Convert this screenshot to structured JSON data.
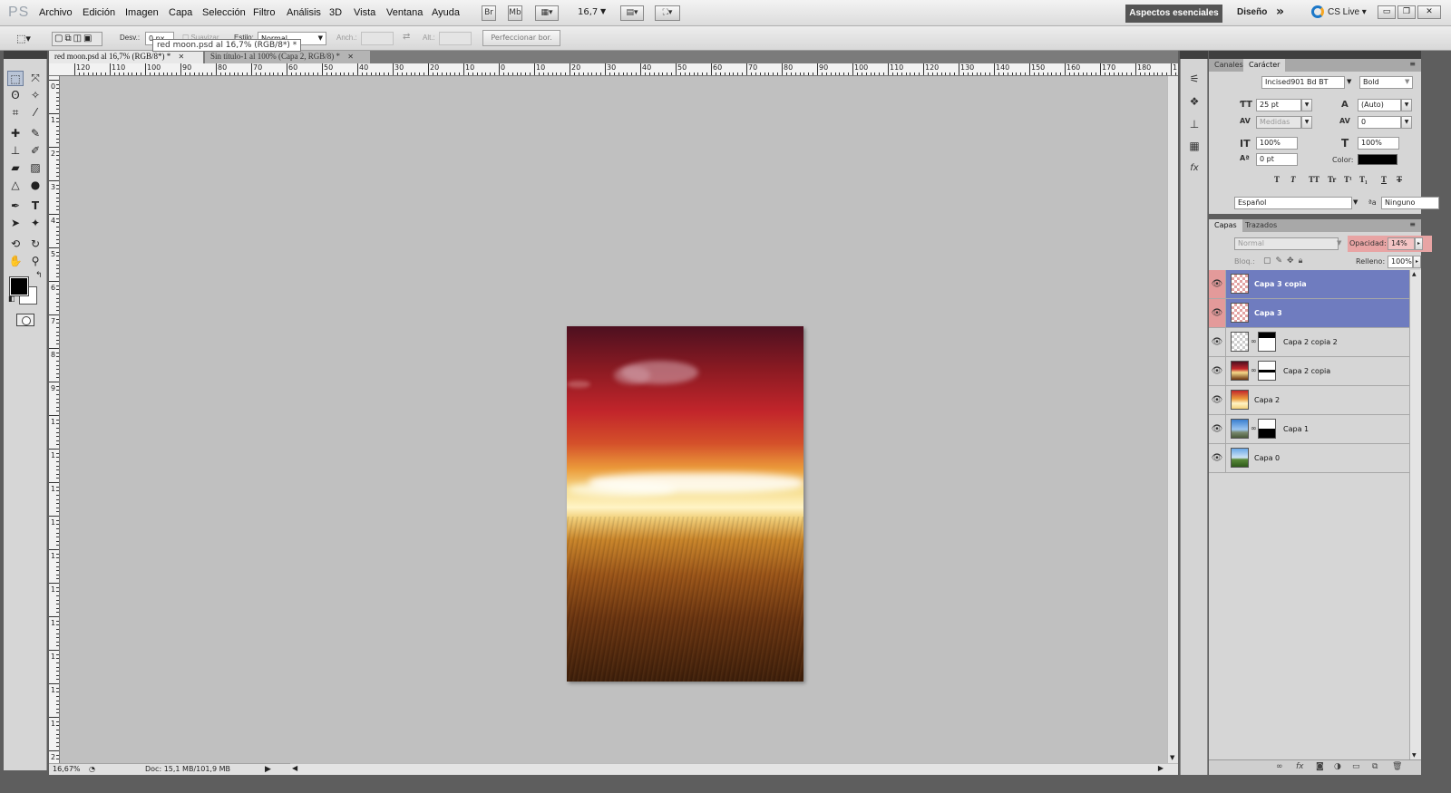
{
  "app": {
    "logo": "PS",
    "menu": [
      "Archivo",
      "Edición",
      "Imagen",
      "Capa",
      "Selección",
      "Filtro",
      "Análisis",
      "3D",
      "Vista",
      "Ventana",
      "Ayuda"
    ],
    "bridge_btn": "Br",
    "minibridge_btn": "Mb",
    "zoom_value": "16,7",
    "workspace": "Aspectos esenciales",
    "workspace_alt": "Diseño",
    "more_workspaces": "»",
    "cs_live": "CS Live",
    "win_minimize": "▭",
    "win_restore": "❐",
    "win_close": "✕"
  },
  "options": {
    "feather_label": "Desv.:",
    "feather_value": "0 px",
    "antialias_label": "Suavizar",
    "style_label": "Estilo:",
    "style_value": "Normal",
    "width_label": "Anch.:",
    "height_label": "Alt.:",
    "refine_edge": "Perfeccionar bor.",
    "tooltip": "red moon.psd al 16,7% (RGB/8*) *"
  },
  "doc_tabs": [
    {
      "label": "red moon.psd al 16,7% (RGB/8*) *",
      "close": "✕"
    },
    {
      "label": "Sin título-1 al 100% (Capa 2, RGB/8) *",
      "close": "✕"
    }
  ],
  "ruler": {
    "h_labels": [
      "120",
      "110",
      "100",
      "90",
      "80",
      "70",
      "60",
      "50",
      "40",
      "30",
      "20",
      "10",
      "0",
      "10",
      "20",
      "30",
      "40",
      "50",
      "60",
      "70",
      "80",
      "90",
      "100",
      "110",
      "120",
      "130",
      "140",
      "150",
      "160",
      "170",
      "180",
      "1"
    ],
    "v_labels": [
      "0",
      "1",
      "2",
      "3",
      "4",
      "5",
      "6",
      "7",
      "8",
      "9",
      "1",
      "1",
      "1",
      "1",
      "1",
      "1",
      "1",
      "1",
      "1",
      "1",
      "2",
      "2"
    ]
  },
  "status": {
    "zoom": "16,67%",
    "doc": "Doc: 15,1 MB/101,9 MB",
    "arrow": "▶"
  },
  "character_panel": {
    "tabs": [
      "Canales",
      "Carácter"
    ],
    "font_family": "Incised901 Bd BT",
    "font_style": "Bold",
    "font_size": "25 pt",
    "leading": "(Auto)",
    "kerning": "Medidas",
    "tracking": "0",
    "vscale": "100%",
    "hscale": "100%",
    "baseline": "0 pt",
    "color_label": "Color:",
    "color_value": "#000000",
    "style_buttons": [
      "T",
      "T",
      "TT",
      "Tr",
      "T¹",
      "T₁",
      "T",
      "T"
    ],
    "language": "Español",
    "antialias": "Ninguno",
    "aa_icon": "ªa"
  },
  "layers_panel": {
    "tabs": [
      "Capas",
      "Trazados"
    ],
    "blend_mode": "Normal",
    "opacity_label": "Opacidad:",
    "opacity_value": "14%",
    "lock_label": "Bloq.:",
    "fill_label": "Relleno:",
    "fill_value": "100%",
    "layers": [
      {
        "name": "Capa 3 copia",
        "selected": true,
        "thumb": "checker",
        "mask": false
      },
      {
        "name": "Capa 3",
        "selected": true,
        "thumb": "checker",
        "mask": false
      },
      {
        "name": "Capa 2 copia 2",
        "selected": false,
        "thumb": "checker-grey",
        "mask": true
      },
      {
        "name": "Capa 2 copia",
        "selected": false,
        "thumb": "sunset",
        "mask": true
      },
      {
        "name": "Capa 2",
        "selected": false,
        "thumb": "gradient",
        "mask": false
      },
      {
        "name": "Capa 1",
        "selected": false,
        "thumb": "sky",
        "mask": true
      },
      {
        "name": "Capa 0",
        "selected": false,
        "thumb": "field",
        "mask": false
      }
    ],
    "footer_icons": [
      "link-icon",
      "fx-icon",
      "mask-icon",
      "adjustment-icon",
      "folder-icon",
      "new-layer-icon",
      "trash-icon"
    ]
  },
  "colors": {
    "accent_selected": "#6f7cbf",
    "eye_selected": "#e39a9a",
    "canvas_bg": "#c0c0c0"
  }
}
